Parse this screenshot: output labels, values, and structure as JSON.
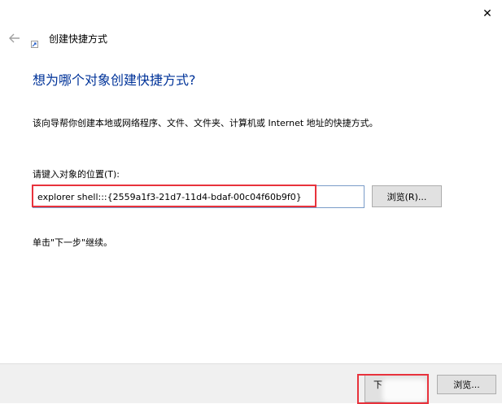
{
  "window": {
    "close_glyph": "✕"
  },
  "header": {
    "back_icon": "back-arrow-icon",
    "wizard_icon": "shortcut-wizard-icon",
    "title": "创建快捷方式"
  },
  "main": {
    "heading": "想为哪个对象创建快捷方式?",
    "description": "该向导帮你创建本地或网络程序、文件、文件夹、计算机或 Internet 地址的快捷方式。",
    "location_label": "请键入对象的位置(T):",
    "location_value": "explorer shell:::{2559a1f3-21d7-11d4-bdaf-00c04f60b9f0}",
    "browse_label": "浏览(R)...",
    "hint": "单击\"下一步\"继续。"
  },
  "footer": {
    "next_label": "下",
    "cancel_label": "浏览..."
  },
  "colors": {
    "heading": "#003399",
    "highlight": "#e8323c",
    "footer_bg": "#f0f0f0"
  }
}
